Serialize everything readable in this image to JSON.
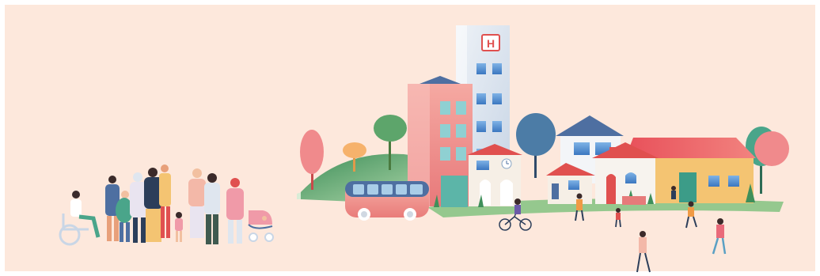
{
  "illustration": {
    "hospital_sign": "H",
    "colors": {
      "background": "#fde8dc",
      "hospital_tower": "#dfe6ef",
      "pink_building": "#ef8f8c",
      "accent_red": "#e0504f",
      "window_blue": "#4f8fcf",
      "grass": "#5aa06a",
      "yellow_house": "#f4c472",
      "bus": "#f2908a"
    },
    "icons": [
      "hospital-icon",
      "clock-icon",
      "bus-icon",
      "bicycle-icon",
      "wheelchair-icon",
      "stroller-icon",
      "tree-icon"
    ]
  }
}
